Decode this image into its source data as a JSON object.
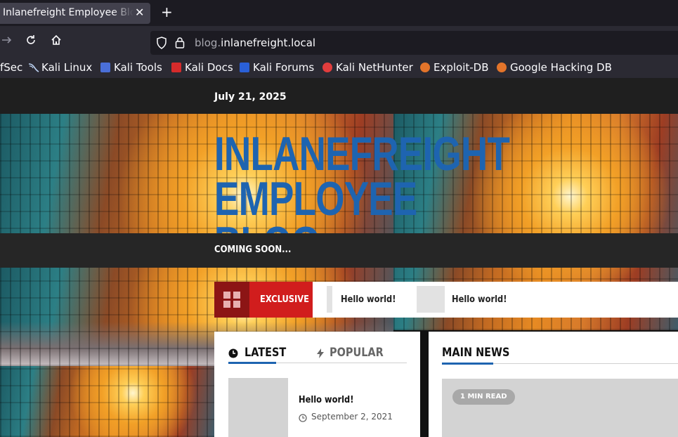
{
  "browser": {
    "tab_title": "Inlanefreight Employee Blog",
    "tab_close": "✕",
    "new_tab": "+",
    "url_prefix": "blog.",
    "url_domain": "inlanefreight.local",
    "bookmarks": [
      {
        "label": "fSec",
        "color": "#3b6fd0"
      },
      {
        "label": "Kali Linux",
        "color": "#bcd2f2"
      },
      {
        "label": "Kali Tools",
        "color": "#4a6fd8"
      },
      {
        "label": "Kali Docs",
        "color": "#d62b2b"
      },
      {
        "label": "Kali Forums",
        "color": "#2a60d8"
      },
      {
        "label": "Kali NetHunter",
        "color": "#e23d3d"
      },
      {
        "label": "Exploit-DB",
        "color": "#e3742a"
      },
      {
        "label": "Google Hacking DB",
        "color": "#e3742a"
      }
    ]
  },
  "site": {
    "date": "July 21, 2025",
    "title_line1": "INLANEFREIGHT",
    "title_line2": "EMPLOYEE BLOG",
    "tagline": "COMING SOON...",
    "ticker_label": "EXCLUSIVE",
    "ticker_items": [
      "Hello world!",
      "Hello world!"
    ],
    "tabs": {
      "latest": "LATEST",
      "popular": "POPULAR"
    },
    "main_news": "MAIN NEWS",
    "post": {
      "title": "Hello world!",
      "date": "September 2, 2021"
    },
    "read_badge": "1 MIN READ"
  },
  "colors": {
    "brand_blue": "#1e64b0",
    "ticker_red": "#d11d1d",
    "ticker_dark_red": "#8c1515"
  }
}
